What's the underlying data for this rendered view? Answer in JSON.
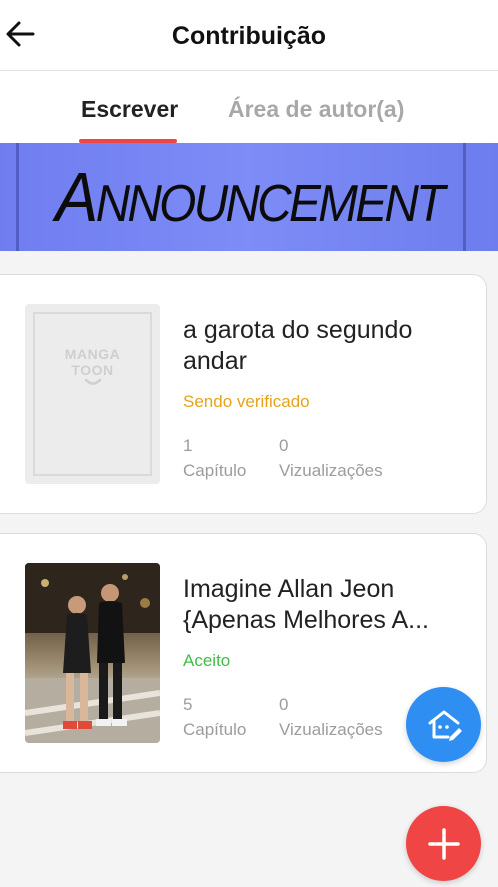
{
  "header": {
    "title": "Contribuição"
  },
  "tabs": [
    {
      "label": "Escrever"
    },
    {
      "label": "Área de autor(a)"
    }
  ],
  "banner": {
    "text_first": "A",
    "text_rest": "NNOUNCEMENT"
  },
  "books": [
    {
      "title": "a garota do segundo andar",
      "status": "Sendo verificado",
      "chapters": "1",
      "chapters_label": "Capítulo",
      "views": "0",
      "views_label": "Vizualizações",
      "cover_text_1": "MANGA",
      "cover_text_2": "TOON"
    },
    {
      "title_line1": "Imagine Allan Jeon",
      "title_line2": "{Apenas Melhores A...",
      "status": "Aceito",
      "chapters": "5",
      "chapters_label": "Capítulo",
      "views": "0",
      "views_label": "Vizualizações"
    }
  ],
  "colors": {
    "accent_red": "#ef4545",
    "fab_blue": "#2f8ef2",
    "status_pending": "#e8a21a",
    "status_accepted": "#3fbd47"
  }
}
